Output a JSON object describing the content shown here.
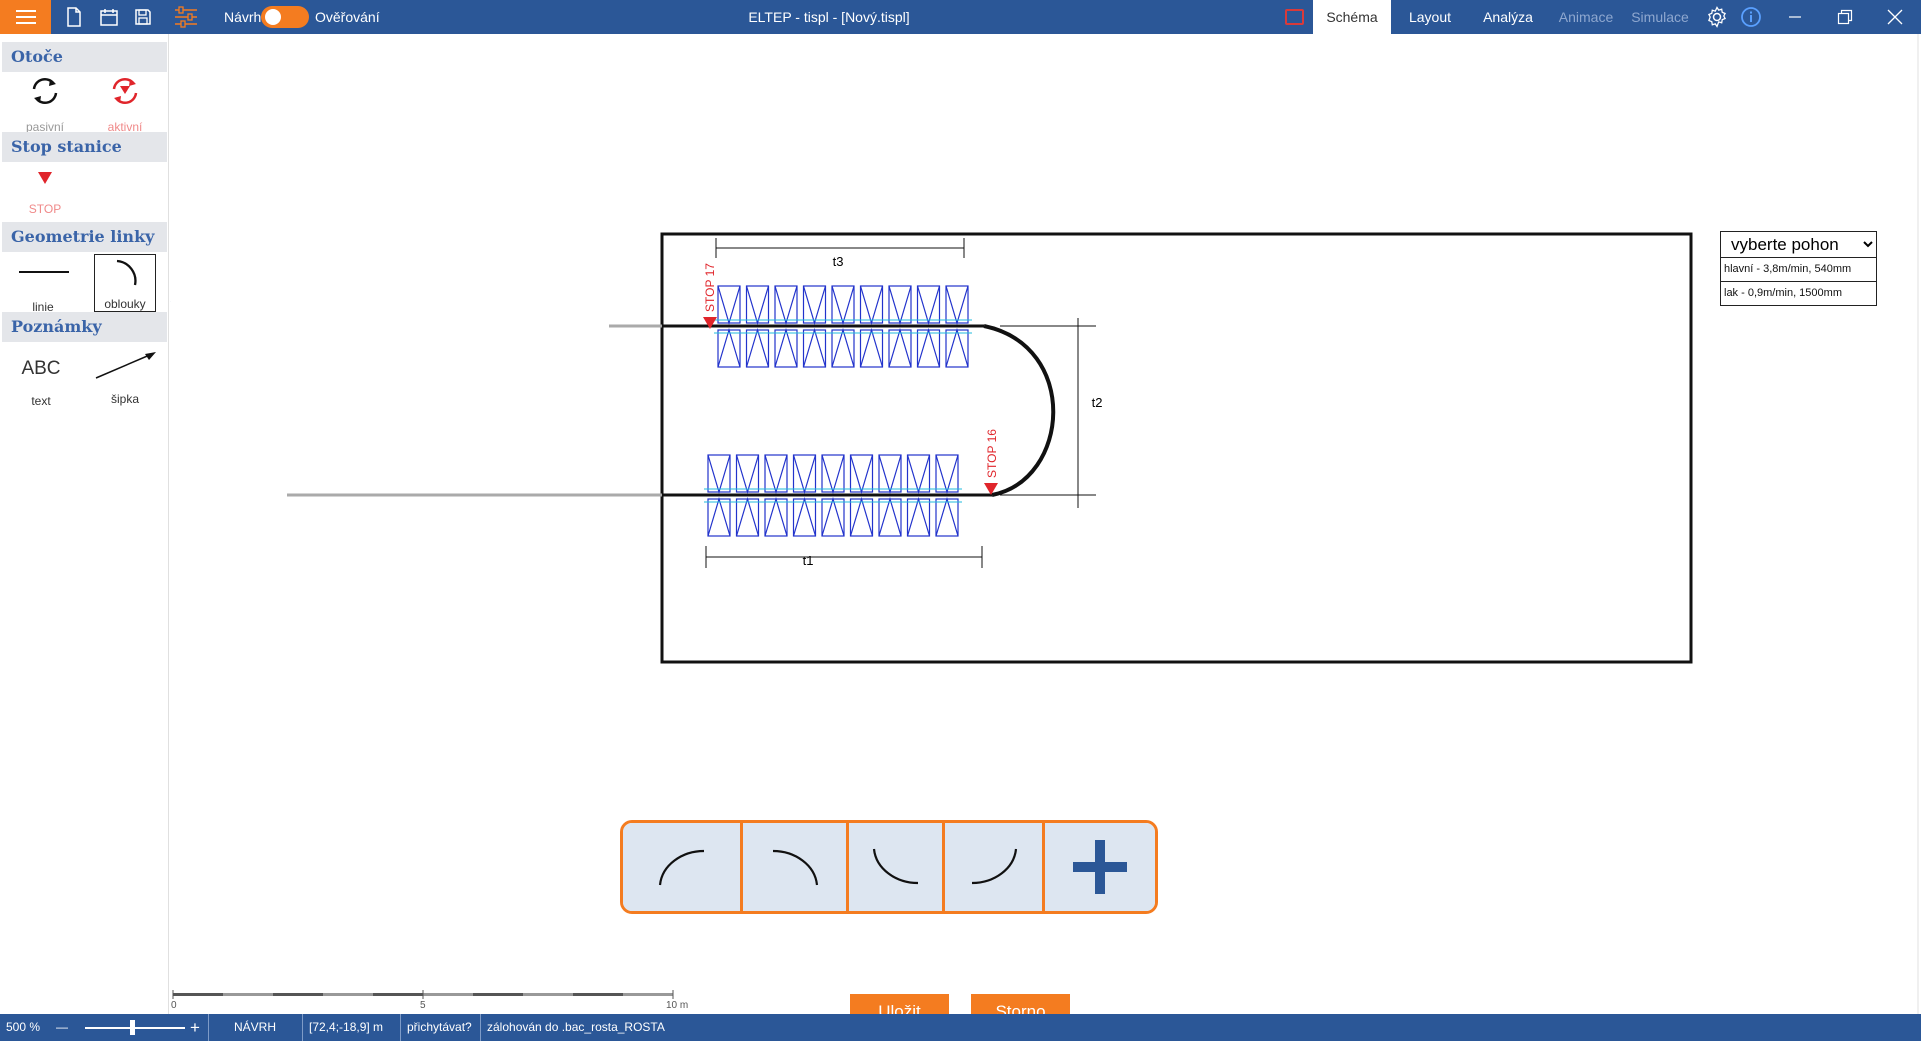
{
  "titlebar": {
    "title": "ELTEP - tispl - [Nový.tispl]",
    "mode_label": "Návrh",
    "verify_label": "Ověřování",
    "tabs": [
      {
        "label": "Schéma",
        "state": "active"
      },
      {
        "label": "Layout",
        "state": "normal"
      },
      {
        "label": "Analýza",
        "state": "normal"
      },
      {
        "label": "Animace",
        "state": "disabled"
      },
      {
        "label": "Simulace",
        "state": "disabled"
      }
    ],
    "icons": [
      "menu-icon",
      "new-file-icon",
      "open-icon",
      "save-icon",
      "settings-sliders-icon",
      "settings-gear-icon",
      "info-icon",
      "minimize-icon",
      "restore-icon",
      "close-icon"
    ],
    "accent_color": "#f47c20",
    "bar_color": "#2b5797"
  },
  "left_panel": {
    "sections": [
      {
        "title": "Otoče",
        "items": [
          {
            "label": "pasivní",
            "icon": "rotate-passive-icon"
          },
          {
            "label": "aktivní",
            "icon": "rotate-active-icon"
          }
        ]
      },
      {
        "title": "Stop stanice",
        "items": [
          {
            "label": "STOP",
            "icon": "stop-triangle-icon"
          }
        ]
      },
      {
        "title": "Geometrie linky",
        "items": [
          {
            "label": "linie",
            "icon": "line-icon"
          },
          {
            "label": "oblouky",
            "icon": "arc-icon"
          }
        ]
      },
      {
        "title": "Poznámky",
        "items": [
          {
            "label": "text",
            "icon": "text-abc-icon",
            "glyph": "ABC"
          },
          {
            "label": "šipka",
            "icon": "arrow-icon"
          }
        ]
      }
    ]
  },
  "canvas": {
    "dimensions": {
      "t1": "t1",
      "t2": "t2",
      "t3": "t3"
    },
    "stops": [
      {
        "label": "STOP 17"
      },
      {
        "label": "STOP 16"
      }
    ],
    "scale": {
      "start": "0",
      "mid": "5",
      "end": "10 m"
    },
    "drive": {
      "placeholder": "vyberte pohon",
      "options": [
        "hlavní - 3,8m/min, 540mm",
        "lak - 0,9m/min, 1500mm"
      ]
    }
  },
  "arc_toolbar": {
    "buttons": [
      "arc-up-right-icon",
      "arc-down-right-icon",
      "arc-bottom-left-icon",
      "arc-bottom-right-icon",
      "plus-icon"
    ]
  },
  "actions": {
    "save": "Uložit",
    "cancel": "Storno"
  },
  "statusbar": {
    "zoom": "500 %",
    "zoom_minus": "—",
    "zoom_plus": "+",
    "zoom_level": 0.47,
    "mode": "NÁVRH",
    "coords": "[72,4;-18,9] m",
    "snap": "přichytávat?",
    "backup": "zálohován do .bac_rosta_ROSTA"
  }
}
